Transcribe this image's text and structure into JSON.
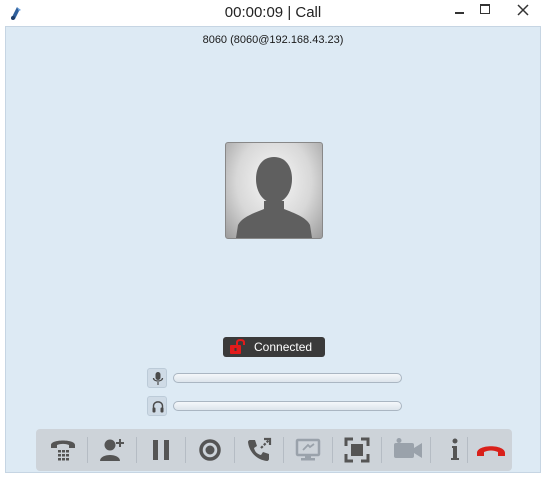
{
  "window": {
    "title": "00:00:09 | Call"
  },
  "call": {
    "remote_party": "8060 (8060@192.168.43.23)",
    "status": "Connected",
    "mic_level": 0,
    "speaker_level": 0
  },
  "toolbar": {
    "buttons": [
      "dialpad-icon",
      "add-contact-icon",
      "pause-icon",
      "record-icon",
      "transfer-icon",
      "screen-share-icon",
      "fullscreen-icon",
      "video-icon",
      "info-icon",
      "hangup-icon"
    ]
  },
  "colors": {
    "client_bg": "#ddeaf4",
    "toolbar_bg": "#cdd3d9",
    "icon_gray": "#555555",
    "hangup_red": "#d9201a",
    "lock_red": "#e21b1b",
    "status_bg": "#3a3a3a"
  }
}
